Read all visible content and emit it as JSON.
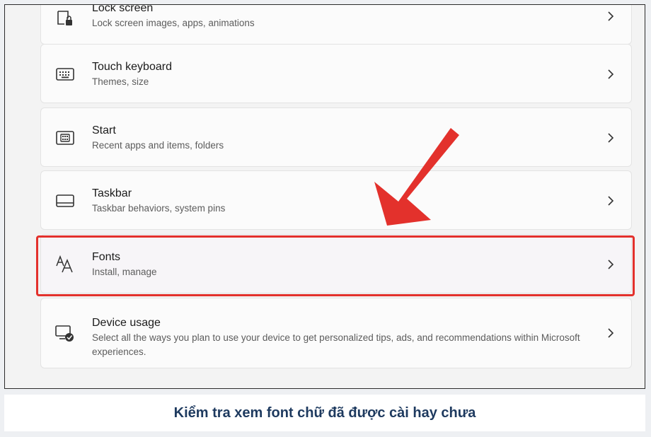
{
  "settings_list": {
    "items": [
      {
        "key": "lock-screen",
        "title": "Lock screen",
        "subtitle": "Lock screen images, apps, animations",
        "icon": "lock-screen-icon"
      },
      {
        "key": "touch-keyboard",
        "title": "Touch keyboard",
        "subtitle": "Themes, size",
        "icon": "keyboard-icon"
      },
      {
        "key": "start",
        "title": "Start",
        "subtitle": "Recent apps and items, folders",
        "icon": "start-icon"
      },
      {
        "key": "taskbar",
        "title": "Taskbar",
        "subtitle": "Taskbar behaviors, system pins",
        "icon": "taskbar-icon"
      },
      {
        "key": "fonts",
        "title": "Fonts",
        "subtitle": "Install, manage",
        "icon": "fonts-icon"
      },
      {
        "key": "device-usage",
        "title": "Device usage",
        "subtitle": "Select all the ways you plan to use your device to get personalized tips, ads, and recommendations within Microsoft experiences.",
        "icon": "device-usage-icon"
      }
    ]
  },
  "annotation": {
    "highlight_color": "#e3312c",
    "arrow_color": "#e3312c",
    "highlighted_item": "fonts"
  },
  "caption": {
    "text": "Kiểm tra xem font chữ đã được cài hay chưa",
    "color": "#1e3a5f"
  }
}
